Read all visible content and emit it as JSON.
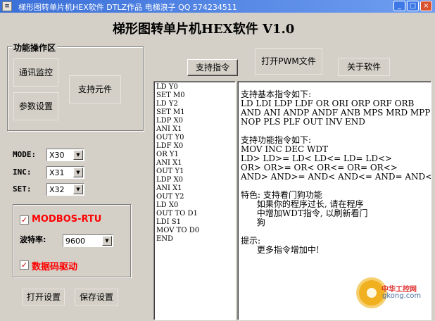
{
  "window": {
    "icon_text": "≡",
    "title": "梯形图转单片机HEX软件  DTLZ作品  电梯浪子 QQ 574234511",
    "btn_min": "_",
    "btn_max": "□",
    "btn_close": "×"
  },
  "app_title": "梯形图转单片机HEX软件  V1.0",
  "func_area": {
    "legend": "功能操作区",
    "comm_monitor": "通讯监控",
    "param_settings": "参数设置",
    "support_components": "支持元件"
  },
  "settings": {
    "mode_label": "MODE:",
    "mode_value": "X30",
    "inc_label": "INC:",
    "inc_value": "X31",
    "set_label": "SET:",
    "set_value": "X32"
  },
  "comm": {
    "modbus_checked": true,
    "modbus_label": "MODBOS-RTU",
    "baud_label": "波特率:",
    "baud_value": "9600",
    "datacode_checked": true,
    "datacode_label": "数据码驱动"
  },
  "bottom_buttons": {
    "open_settings": "打开设置",
    "save_settings": "保存设置"
  },
  "top_buttons": {
    "supported_instructions": "支持指令",
    "open_pwm": "打开PWM文件",
    "about": "关于软件"
  },
  "program_text": "LD Y0\nSET M0\nLD Y2\nSET M1\nLDP X0\nANI X1\nOUT Y0\nLDF X0\nOR Y1\nANI X1\nOUT Y1\nLDP X0\nANI X1\nOUT Y2\nLD X0\nOUT TO D1\nLDI S1\nMOV TO D0\nEND",
  "help_text": "支持基本指令如下:\nLD LDI LDP LDF OR ORI ORP ORF ORB\nAND ANI ANDP ANDF ANB MPS MRD MPP\nNOP PLS PLF OUT INV END\n\n支持功能指令如下:\nMOV INC DEC WDT\nLD> LD>= LD< LD<= LD= LD<>\nOR> OR>= OR< OR<= OR= OR<>\nAND> AND>= AND< AND<= AND= AND<>\n\n特色: 支持看门狗功能\n      如果你的程序过长, 请在程序\n      中增加WDT指令, 以刷新看门\n      狗\n\n提示:\n      更多指令增加中!",
  "watermark": {
    "line1": "中华工控网",
    "line2": "gkong.com"
  }
}
